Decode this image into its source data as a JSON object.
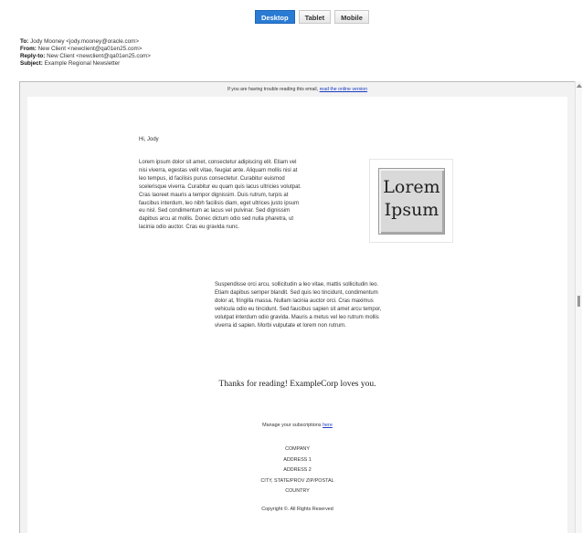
{
  "tabs": {
    "desktop": "Desktop",
    "tablet": "Tablet",
    "mobile": "Mobile"
  },
  "headers": {
    "to_label": "To",
    "to_value": "Jody Mooney <jody.mooney@oracle.com>",
    "from_label": "From",
    "from_value": "New Client <newclient@qa01en25.com>",
    "replyto_label": "Reply-to",
    "replyto_value": "New Client <newclient@qa01en25.com>",
    "subject_label": "Subject",
    "subject_value": "Example Regional Newsletter"
  },
  "email": {
    "trouble_text": "If you are having trouble reading this email,",
    "trouble_link": "read the online version",
    "greeting": "Hi, Jody",
    "paragraph1": "Lorem ipsum dolor sit amet, consectetur adipiscing elit. Etiam vel nisi viverra, egestas velit vitae, feugiat ante. Aliquam mollis nisl at leo tempus, id facilisis purus consectetur. Curabitur euismod scelerisque viverra. Curabitur eu quam quis lacus ultricies volutpat. Cras laoreet mauris a tempor dignissim. Duis rutrum, turpis at faucibus interdum, leo nibh facilisis diam, eget ultrices justo ipsum eu nisl. Sed condimentum ac lacus vel pulvinar. Sed dignissim dapibus arcu at mollis. Donec dictum odio sed nulla pharetra, ut lacinia odio auctor. Cras eu gravida nunc.",
    "paragraph2": "Suspendisse orci arcu, sollicitudin a leo vitae, mattis sollicitudin leo. Etiam dapibus semper blandit. Sed quis leo tincidunt, condimentum dolor at, fringilla massa. Nullam lacinia auctor orci. Cras maximus vehicula odio eu tincidunt. Sed faucibus sapien sit amet arcu tempor, volutpat interdum odio gravida. Mauris a metus vel leo rutrum mollis viverra id sapien. Morbi vulputate et lorem non rutrum.",
    "image_line1": "Lorem",
    "image_line2": "Ipsum",
    "thanks": "Thanks for reading! ExampleCorp loves you.",
    "manage_text": "Manage your subscriptions",
    "manage_link": "here",
    "company": "COMPANY",
    "address1": "ADDRESS 1",
    "address2": "ADDRESS 2",
    "city_line": "CITY, STATE/PROV ZIP/POSTAL",
    "country": "COUNTRY",
    "copyright": "Copyright ©. All Rights Reserved"
  },
  "colors": {
    "active_tab": "#2a7bd3",
    "link": "#1a3cc4",
    "viewer_bg": "#f2f2f2"
  }
}
